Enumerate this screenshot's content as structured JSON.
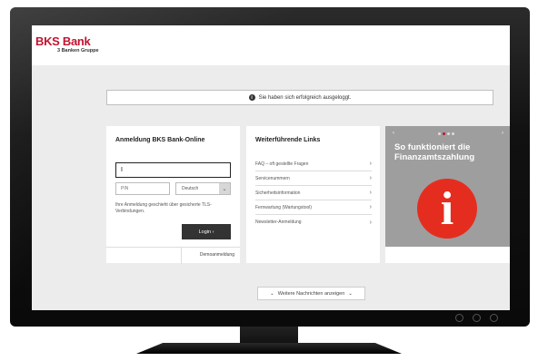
{
  "brand": {
    "name": "BKS Bank",
    "tagline": "3 Banken Gruppe",
    "color": "#c4122f"
  },
  "notice": {
    "icon": "info-icon",
    "text": "Sie haben sich erfolgreich ausgeloggt."
  },
  "login": {
    "title": "Anmeldung BKS Bank-Online",
    "user_value": "I",
    "pin_placeholder": "PIN",
    "language": "Deutsch",
    "tls_note": "Ihre Anmeldung geschieht über gesicherte TLS-Verbindungen.",
    "login_label": "Login",
    "demo_label": "Demoanmeldung"
  },
  "links": {
    "title": "Weiterführende Links",
    "items": [
      "FAQ – oft gestellte Fragen",
      "Servicenummern",
      "Sicherheitsinformation",
      "Fernwartung (Wartungstool)",
      "Newsletter-Anmeldung"
    ]
  },
  "promo": {
    "title": "So funktioniert die Finanzamtszahlung",
    "icon": "info-icon",
    "accent": "#e52d1f",
    "slide_count": 4,
    "active_slide": 2
  },
  "more_news": {
    "label": "Weitere Nachrichten anzeigen"
  }
}
